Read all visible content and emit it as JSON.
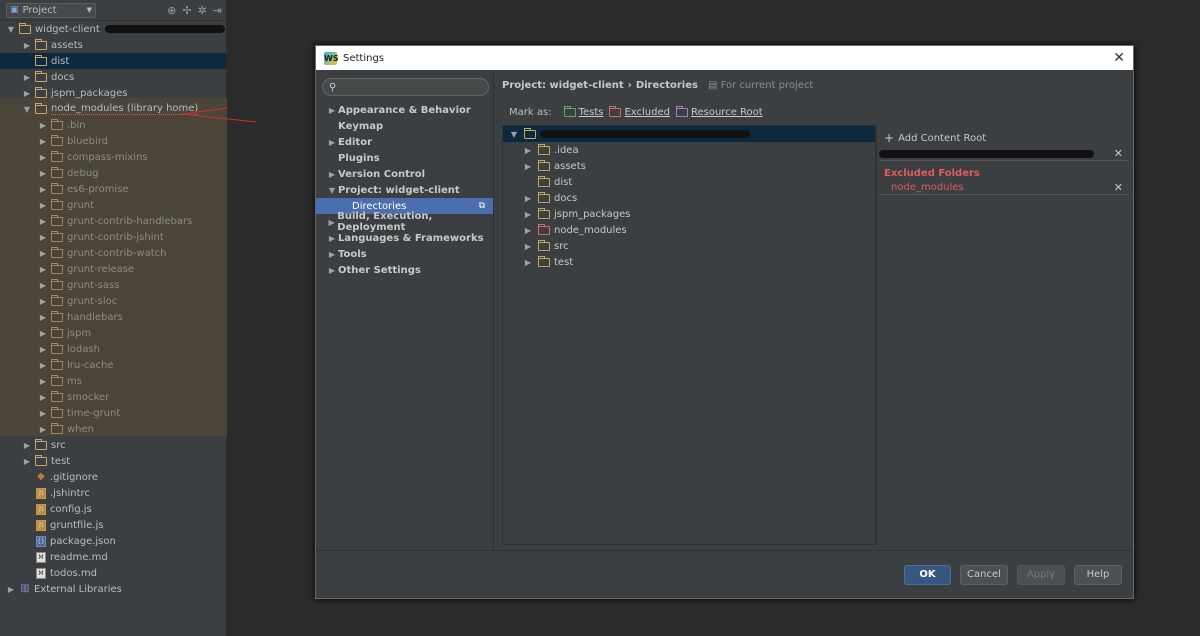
{
  "project_panel": {
    "title": "Project",
    "header_icons": [
      "target-icon",
      "collapse-icon",
      "gear-icon",
      "hide-icon"
    ],
    "root": {
      "label": "widget-client"
    },
    "node_modules_label": "node_modules (library home)",
    "top_items": [
      "assets",
      "dist",
      "docs",
      "jspm_packages"
    ],
    "node_modules_children": [
      ".bin",
      "bluebird",
      "compass-mixins",
      "debug",
      "es6-promise",
      "grunt",
      "grunt-contrib-handlebars",
      "grunt-contrib-jshint",
      "grunt-contrib-watch",
      "grunt-release",
      "grunt-sass",
      "grunt-sloc",
      "handlebars",
      "jspm",
      "lodash",
      "lru-cache",
      "ms",
      "smocker",
      "time-grunt",
      "when"
    ],
    "after_items": [
      "src",
      "test"
    ],
    "files": [
      {
        "name": ".gitignore",
        "icon": "git-icon"
      },
      {
        "name": ".jshintrc",
        "icon": "js-icon"
      },
      {
        "name": "config.js",
        "icon": "js-icon"
      },
      {
        "name": "gruntfile.js",
        "icon": "js-icon"
      },
      {
        "name": "package.json",
        "icon": "json-icon"
      },
      {
        "name": "readme.md",
        "icon": "md-icon"
      },
      {
        "name": "todos.md",
        "icon": "md-icon"
      }
    ],
    "external_libraries": "External Libraries"
  },
  "dialog": {
    "title": "Settings",
    "nav": [
      {
        "label": "Appearance & Behavior",
        "arrow": "▶"
      },
      {
        "label": "Keymap",
        "arrow": ""
      },
      {
        "label": "Editor",
        "arrow": "▶"
      },
      {
        "label": "Plugins",
        "arrow": ""
      },
      {
        "label": "Version Control",
        "arrow": "▶"
      },
      {
        "label": "Project: widget-client",
        "arrow": "▼"
      },
      {
        "label": "Directories",
        "arrow": "",
        "selected": true
      },
      {
        "label": "Build, Execution, Deployment",
        "arrow": "▶"
      },
      {
        "label": "Languages & Frameworks",
        "arrow": "▶"
      },
      {
        "label": "Tools",
        "arrow": "▶"
      },
      {
        "label": "Other Settings",
        "arrow": "▶"
      }
    ],
    "breadcrumb": {
      "project": "Project: widget-client",
      "separator": "›",
      "page": "Directories",
      "scope": "For current project"
    },
    "mark_as": {
      "label": "Mark as:",
      "tests": "Tests",
      "excluded": "Excluded",
      "resource_root": "Resource Root"
    },
    "dir_tree": [
      {
        "name": ".idea",
        "arrow": "▶"
      },
      {
        "name": "assets",
        "arrow": "▶"
      },
      {
        "name": "dist",
        "arrow": ""
      },
      {
        "name": "docs",
        "arrow": "▶"
      },
      {
        "name": "jspm_packages",
        "arrow": "▶"
      },
      {
        "name": "node_modules",
        "arrow": "▶",
        "excluded": true
      },
      {
        "name": "src",
        "arrow": "▶"
      },
      {
        "name": "test",
        "arrow": "▶"
      }
    ],
    "add_content_root": "Add Content Root",
    "excluded_folders_title": "Excluded Folders",
    "excluded_folders": [
      "node_modules"
    ],
    "buttons": {
      "ok": "OK",
      "cancel": "Cancel",
      "apply": "Apply",
      "help": "Help"
    }
  },
  "colors": {
    "accent": "#4b6eaf",
    "excluded": "#e25a5a",
    "library_bg": "#4a4538"
  }
}
